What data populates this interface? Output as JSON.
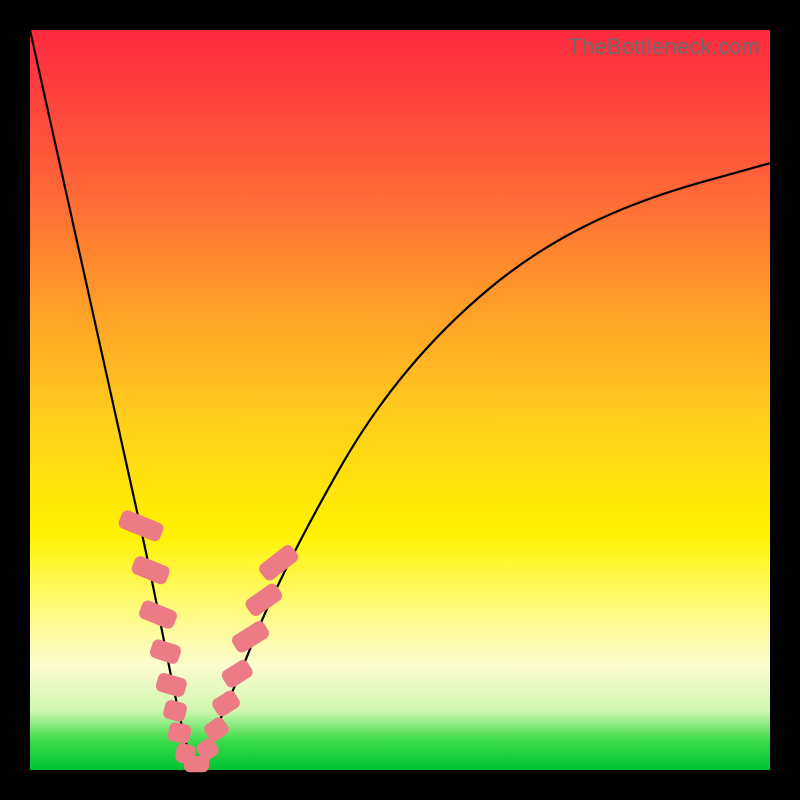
{
  "watermark": "TheBottleneck.com",
  "chart_data": {
    "type": "line",
    "title": "",
    "xlabel": "",
    "ylabel": "",
    "xlim": [
      0,
      100
    ],
    "ylim": [
      0,
      100
    ],
    "grid": false,
    "legend": false,
    "series": [
      {
        "name": "curve",
        "x": [
          0,
          4,
          8,
          12,
          14,
          16,
          18,
          20,
          22,
          24,
          28,
          32,
          38,
          46,
          56,
          68,
          82,
          100
        ],
        "y": [
          100,
          82,
          64,
          46,
          37,
          28,
          18,
          8,
          0,
          3,
          12,
          22,
          34,
          48,
          60,
          70,
          77,
          82
        ]
      }
    ],
    "markers": [
      {
        "type": "capsule",
        "cx": 15.0,
        "cy": 33.0,
        "w": 2.6,
        "h": 6.0,
        "angle": -68
      },
      {
        "type": "capsule",
        "cx": 16.3,
        "cy": 27.0,
        "w": 2.6,
        "h": 5.0,
        "angle": -68
      },
      {
        "type": "capsule",
        "cx": 17.3,
        "cy": 21.0,
        "w": 2.6,
        "h": 5.0,
        "angle": -68
      },
      {
        "type": "capsule",
        "cx": 18.3,
        "cy": 16.0,
        "w": 2.6,
        "h": 4.0,
        "angle": -72
      },
      {
        "type": "capsule",
        "cx": 19.1,
        "cy": 11.5,
        "w": 2.6,
        "h": 4.0,
        "angle": -74
      },
      {
        "type": "capsule",
        "cx": 19.6,
        "cy": 8.0,
        "w": 2.6,
        "h": 3.0,
        "angle": -76
      },
      {
        "type": "capsule",
        "cx": 20.2,
        "cy": 5.0,
        "w": 2.6,
        "h": 3.0,
        "angle": -78
      },
      {
        "type": "capsule",
        "cx": 21.0,
        "cy": 2.2,
        "w": 2.6,
        "h": 2.6,
        "angle": -80
      },
      {
        "type": "capsule",
        "cx": 22.5,
        "cy": 0.8,
        "w": 3.4,
        "h": 2.2,
        "angle": 0
      },
      {
        "type": "capsule",
        "cx": 24.0,
        "cy": 2.8,
        "w": 2.6,
        "h": 2.6,
        "angle": 55
      },
      {
        "type": "capsule",
        "cx": 25.2,
        "cy": 5.5,
        "w": 2.6,
        "h": 3.0,
        "angle": 55
      },
      {
        "type": "capsule",
        "cx": 26.5,
        "cy": 9.0,
        "w": 2.6,
        "h": 3.5,
        "angle": 58
      },
      {
        "type": "capsule",
        "cx": 28.0,
        "cy": 13.0,
        "w": 2.6,
        "h": 4.0,
        "angle": 58
      },
      {
        "type": "capsule",
        "cx": 29.8,
        "cy": 18.0,
        "w": 2.6,
        "h": 5.0,
        "angle": 58
      },
      {
        "type": "capsule",
        "cx": 31.6,
        "cy": 23.0,
        "w": 2.6,
        "h": 5.0,
        "angle": 55
      },
      {
        "type": "capsule",
        "cx": 33.6,
        "cy": 28.0,
        "w": 2.6,
        "h": 5.5,
        "angle": 52
      }
    ],
    "background_gradient": {
      "top": "#ff2a3f",
      "mid": "#fff200",
      "bottom": "#00c234"
    }
  }
}
